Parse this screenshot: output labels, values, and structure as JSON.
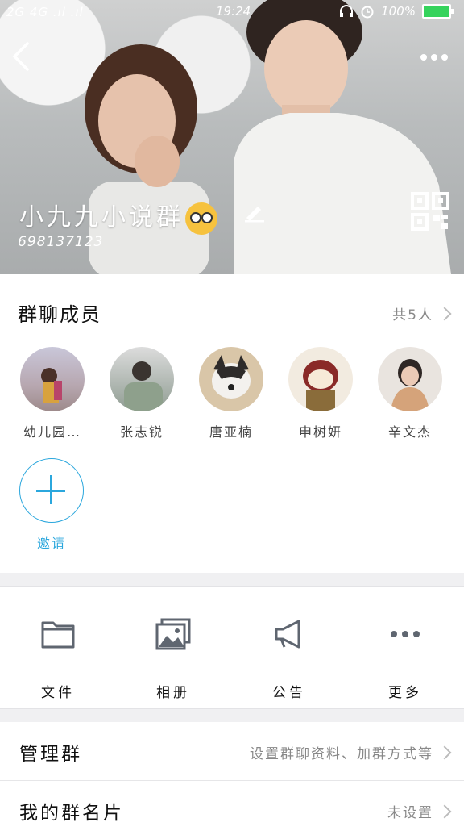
{
  "status_bar": {
    "signal": "2G 4G .ıl .ıl",
    "time": "19:24",
    "battery": "100%"
  },
  "header": {
    "group_name": "小九九小说群",
    "group_id": "698137123"
  },
  "members": {
    "title": "群聊成员",
    "count_label": "共5人",
    "items": [
      {
        "name": "幼儿园…"
      },
      {
        "name": "张志锐"
      },
      {
        "name": "唐亚楠"
      },
      {
        "name": "申树妍"
      },
      {
        "name": "辛文杰"
      }
    ],
    "invite_label": "邀请"
  },
  "actions": [
    {
      "label": "文件",
      "icon": "folder-icon"
    },
    {
      "label": "相册",
      "icon": "photo-album-icon"
    },
    {
      "label": "公告",
      "icon": "megaphone-icon"
    },
    {
      "label": "更多",
      "icon": "more-icon"
    }
  ],
  "rows": {
    "manage": {
      "label": "管理群",
      "value": "设置群聊资料、加群方式等"
    },
    "card": {
      "label": "我的群名片",
      "value": "未设置"
    }
  },
  "colors": {
    "accent": "#2ba7dd",
    "icon_gray": "#5f6670"
  }
}
